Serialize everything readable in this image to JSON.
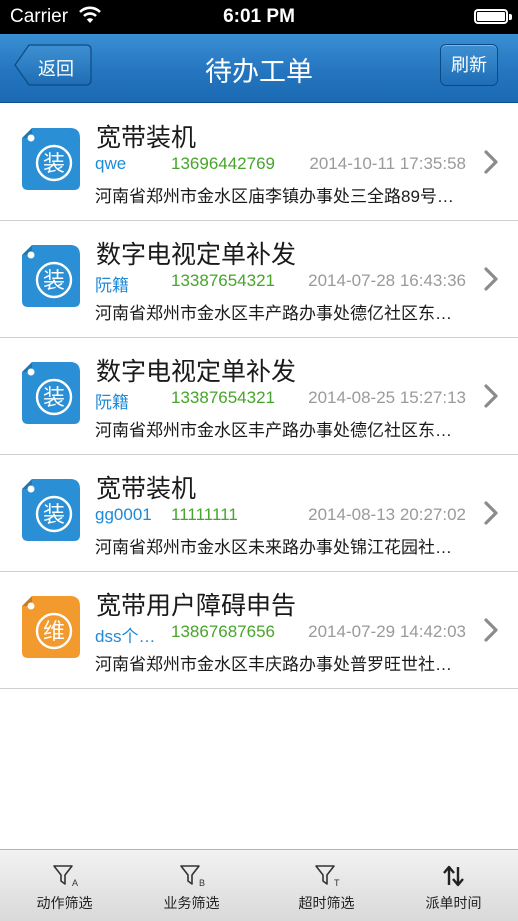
{
  "status_bar": {
    "carrier": "Carrier",
    "time": "6:01 PM"
  },
  "nav": {
    "back_label": "返回",
    "title": "待办工单",
    "refresh_label": "刷新"
  },
  "orders": [
    {
      "badge": "装",
      "badge_color": "#2a8fd4",
      "title": "宽带装机",
      "user": "qwe",
      "phone": "13696442769",
      "date": "2014-10-11 17:35:58",
      "address": "河南省郑州市金水区庙李镇办事处三全路89号…"
    },
    {
      "badge": "装",
      "badge_color": "#2a8fd4",
      "title": "数字电视定单补发",
      "user": "阮籍",
      "phone": "13387654321",
      "date": "2014-07-28 16:43:36",
      "address": "河南省郑州市金水区丰产路办事处德亿社区东…"
    },
    {
      "badge": "装",
      "badge_color": "#2a8fd4",
      "title": "数字电视定单补发",
      "user": "阮籍",
      "phone": "13387654321",
      "date": "2014-08-25 15:27:13",
      "address": "河南省郑州市金水区丰产路办事处德亿社区东…"
    },
    {
      "badge": "装",
      "badge_color": "#2a8fd4",
      "title": "宽带装机",
      "user": "gg0001",
      "phone": "11111111",
      "date": "2014-08-13 20:27:02",
      "address": "河南省郑州市金水区未来路办事处锦江花园社…"
    },
    {
      "badge": "维",
      "badge_color": "#f29a2e",
      "title": "宽带用户障碍申告",
      "user": "dss个…",
      "phone": "13867687656",
      "date": "2014-07-29 14:42:03",
      "address": "河南省郑州市金水区丰庆路办事处普罗旺世社…"
    }
  ],
  "tabs": [
    {
      "label": "动作筛选",
      "icon": "filter-a-icon",
      "icon_letter": "A"
    },
    {
      "label": "业务筛选",
      "icon": "filter-b-icon",
      "icon_letter": "B"
    },
    {
      "label": "超时筛选",
      "icon": "filter-t-icon",
      "icon_letter": "T"
    },
    {
      "label": "派单时间",
      "icon": "sort-arrows-icon"
    }
  ]
}
